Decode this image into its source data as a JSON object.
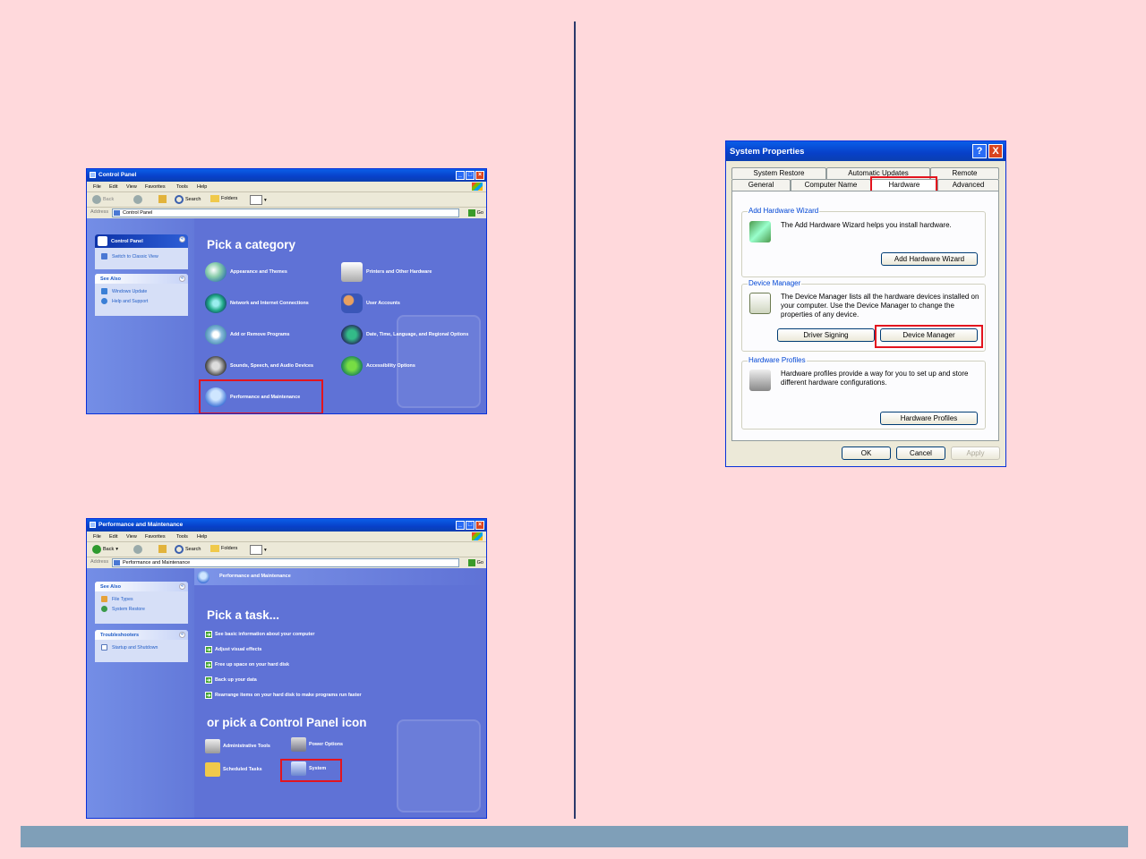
{
  "colors": {
    "background": "#ffd9dc",
    "xp_blue": "#0a5ee8",
    "cp_blue": "#5f72d6",
    "highlight_red": "#e3141e",
    "bottom_bar": "#7f9fb8"
  },
  "menu": [
    "File",
    "Edit",
    "View",
    "Favorites",
    "Tools",
    "Help"
  ],
  "toolbar": {
    "back": "Back",
    "search": "Search",
    "folders": "Folders"
  },
  "addr_label": "Address",
  "go": "Go",
  "cp": {
    "title": "Control Panel",
    "address": "Control Panel",
    "panel_header": "Control Panel",
    "switch_view": "Switch to Classic View",
    "see_also": "See Also",
    "see_also_items": [
      "Windows Update",
      "Help and Support"
    ],
    "heading": "Pick a category",
    "categories": [
      {
        "label": "Appearance and Themes",
        "icon": "appearance-icon"
      },
      {
        "label": "Printers and Other Hardware",
        "icon": "printer-icon"
      },
      {
        "label": "Network and Internet Connections",
        "icon": "network-icon"
      },
      {
        "label": "User Accounts",
        "icon": "users-icon"
      },
      {
        "label": "Add or Remove Programs",
        "icon": "programs-icon"
      },
      {
        "label": "Date, Time, Language, and Regional Options",
        "icon": "clock-globe-icon"
      },
      {
        "label": "Sounds, Speech, and Audio Devices",
        "icon": "speaker-icon"
      },
      {
        "label": "Accessibility Options",
        "icon": "accessibility-icon"
      },
      {
        "label": "Performance and Maintenance",
        "icon": "performance-icon"
      }
    ]
  },
  "pm": {
    "title": "Performance and Maintenance",
    "address": "Performance and Maintenance",
    "see_also": "See Also",
    "see_also_items": [
      "File Types",
      "System Restore"
    ],
    "troubleshooters": "Troubleshooters",
    "troubleshooter_items": [
      "Startup and Shutdown"
    ],
    "banner": "Performance and Maintenance",
    "task_heading": "Pick a task...",
    "tasks": [
      "See basic information about your computer",
      "Adjust visual effects",
      "Free up space on your hard disk",
      "Back up your data",
      "Rearrange items on your hard disk to make programs run faster"
    ],
    "icon_heading": "or pick a Control Panel icon",
    "icons": [
      "Administrative Tools",
      "Power Options",
      "Scheduled Tasks",
      "System"
    ]
  },
  "sys": {
    "title": "System Properties",
    "help": "?",
    "close": "X",
    "tabs_back": [
      "System Restore",
      "Automatic Updates",
      "Remote"
    ],
    "tabs_front": [
      "General",
      "Computer Name",
      "Hardware",
      "Advanced"
    ],
    "add_hw_title": "Add Hardware Wizard",
    "add_hw_text": "The Add Hardware Wizard helps you install hardware.",
    "add_hw_button": "Add Hardware Wizard",
    "dm_title": "Device Manager",
    "dm_text": "The Device Manager lists all the hardware devices installed on your computer. Use the Device Manager to change the properties of any device.",
    "driver_signing": "Driver Signing",
    "dm_button": "Device Manager",
    "hp_title": "Hardware Profiles",
    "hp_text": "Hardware profiles provide a way for you to set up and store different hardware configurations.",
    "hp_button": "Hardware Profiles",
    "ok": "OK",
    "cancel": "Cancel",
    "apply": "Apply"
  }
}
